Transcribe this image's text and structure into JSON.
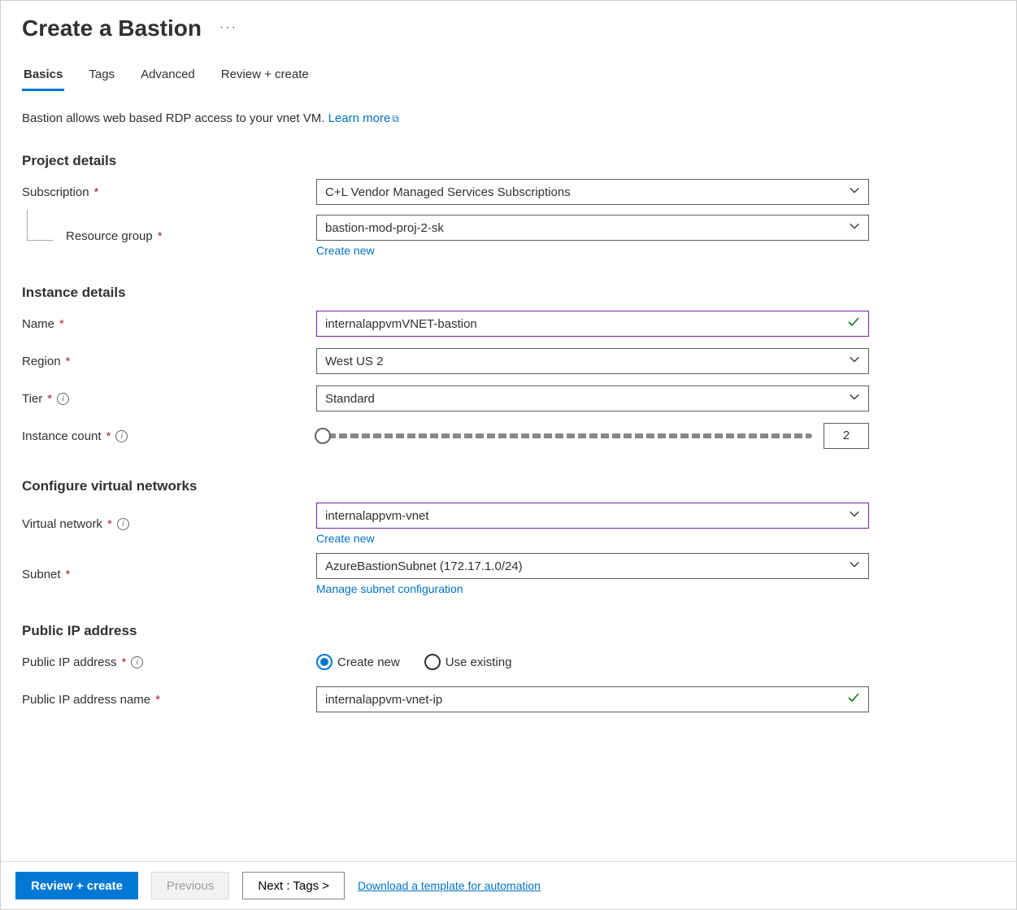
{
  "header": {
    "title": "Create a Bastion",
    "more": "···"
  },
  "tabs": {
    "basics": "Basics",
    "tags": "Tags",
    "advanced": "Advanced",
    "review": "Review + create"
  },
  "intro": {
    "text": "Bastion allows web based RDP access to your vnet VM.  ",
    "learn_more": "Learn more"
  },
  "sections": {
    "project": "Project details",
    "instance": "Instance details",
    "vnet": "Configure virtual networks",
    "pip": "Public IP address"
  },
  "labels": {
    "subscription": "Subscription",
    "resource_group": "Resource group",
    "name": "Name",
    "region": "Region",
    "tier": "Tier",
    "instance_count": "Instance count",
    "virtual_network": "Virtual network",
    "subnet": "Subnet",
    "public_ip": "Public IP address",
    "public_ip_name": "Public IP address name"
  },
  "links": {
    "create_new": "Create new",
    "manage_subnet": "Manage subnet configuration",
    "download_template": "Download a template for automation"
  },
  "values": {
    "subscription": "C+L Vendor Managed Services Subscriptions",
    "resource_group": "bastion-mod-proj-2-sk",
    "name": "internalappvmVNET-bastion",
    "region": "West US 2",
    "tier": "Standard",
    "instance_count": "2",
    "virtual_network": "internalappvm-vnet",
    "subnet": "AzureBastionSubnet (172.17.1.0/24)",
    "public_ip_name": "internalappvm-vnet-ip"
  },
  "radio": {
    "create_new": "Create new",
    "use_existing": "Use existing"
  },
  "footer": {
    "review": "Review + create",
    "previous": "Previous",
    "next": "Next : Tags >"
  }
}
